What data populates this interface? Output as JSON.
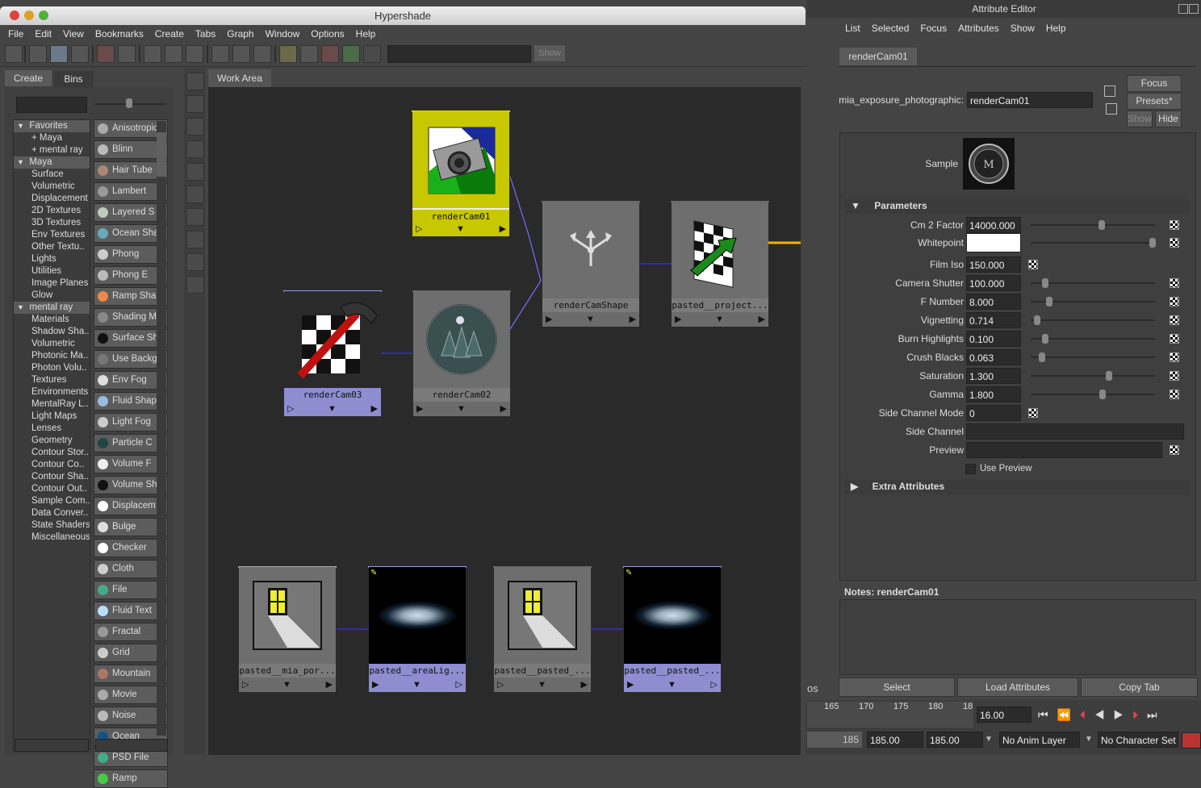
{
  "hypershade": {
    "title": "Hypershade",
    "menu": [
      "File",
      "Edit",
      "View",
      "Bookmarks",
      "Create",
      "Tabs",
      "Graph",
      "Window",
      "Options",
      "Help"
    ],
    "show_button": "Show",
    "left_tabs": [
      "Create",
      "Bins"
    ],
    "favorites": [
      {
        "label": "Favorites",
        "head": true,
        "arrow": "▼"
      },
      {
        "label": "+ Maya",
        "head": false
      },
      {
        "label": "+ mental ray",
        "head": false
      },
      {
        "label": "Maya",
        "head": true,
        "arrow": "▼"
      },
      {
        "label": "Surface"
      },
      {
        "label": "Volumetric"
      },
      {
        "label": "Displacement"
      },
      {
        "label": "2D Textures"
      },
      {
        "label": "3D Textures"
      },
      {
        "label": "Env Textures"
      },
      {
        "label": "Other Textu.."
      },
      {
        "label": "Lights"
      },
      {
        "label": "Utilities"
      },
      {
        "label": "Image Planes"
      },
      {
        "label": "Glow"
      },
      {
        "label": "mental ray",
        "head": true,
        "arrow": "▼"
      },
      {
        "label": "Materials"
      },
      {
        "label": "Shadow Sha.."
      },
      {
        "label": "Volumetric"
      },
      {
        "label": "Photonic Ma.."
      },
      {
        "label": "Photon Volu.."
      },
      {
        "label": "Textures"
      },
      {
        "label": "Environments"
      },
      {
        "label": "MentalRay L.."
      },
      {
        "label": "Light Maps"
      },
      {
        "label": "Lenses"
      },
      {
        "label": "Geometry"
      },
      {
        "label": "Contour Stor.."
      },
      {
        "label": "Contour Co.."
      },
      {
        "label": "Contour Sha.."
      },
      {
        "label": "Contour Out.."
      },
      {
        "label": "Sample Com.."
      },
      {
        "label": "Data Conver.."
      },
      {
        "label": "State Shaders"
      },
      {
        "label": "Miscellaneous"
      }
    ],
    "nodes_list": [
      {
        "label": "Anisotropic",
        "color": "#aaa"
      },
      {
        "label": "Blinn",
        "color": "#bbb"
      },
      {
        "label": "Hair Tube",
        "color": "#a87"
      },
      {
        "label": "Lambert",
        "color": "#999"
      },
      {
        "label": "Layered S",
        "color": "#bcb"
      },
      {
        "label": "Ocean Sha",
        "color": "#6ab"
      },
      {
        "label": "Phong",
        "color": "#ccc"
      },
      {
        "label": "Phong E",
        "color": "#bbb"
      },
      {
        "label": "Ramp Sha",
        "color": "#e84"
      },
      {
        "label": "Shading M",
        "color": "#888"
      },
      {
        "label": "Surface Sh",
        "color": "#111"
      },
      {
        "label": "Use Backg",
        "color": "#777"
      },
      {
        "label": "Env Fog",
        "color": "#ddd"
      },
      {
        "label": "Fluid Shap",
        "color": "#9bd"
      },
      {
        "label": "Light Fog",
        "color": "#ccc"
      },
      {
        "label": "Particle C",
        "color": "#244"
      },
      {
        "label": "Volume F",
        "color": "#eee"
      },
      {
        "label": "Volume Sh",
        "color": "#111"
      },
      {
        "label": "Displacem",
        "color": "#fff"
      },
      {
        "label": "Bulge",
        "color": "#ddd"
      },
      {
        "label": "Checker",
        "color": "#fff"
      },
      {
        "label": "Cloth",
        "color": "#ccc"
      },
      {
        "label": "File",
        "color": "#4a8"
      },
      {
        "label": "Fluid Text",
        "color": "#bdf"
      },
      {
        "label": "Fractal",
        "color": "#999"
      },
      {
        "label": "Grid",
        "color": "#ccc"
      },
      {
        "label": "Mountain",
        "color": "#a76"
      },
      {
        "label": "Movie",
        "color": "#aaa"
      },
      {
        "label": "Noise",
        "color": "#bbb"
      },
      {
        "label": "Ocean",
        "color": "#158"
      },
      {
        "label": "PSD File",
        "color": "#4a8"
      },
      {
        "label": "Ramp",
        "color": "#4c4"
      }
    ],
    "work_tab": "Work Area",
    "graph_nodes": [
      {
        "label": "renderCam01",
        "style": "selected"
      },
      {
        "label": "renderCamShape",
        "style": "normal"
      },
      {
        "label": "pasted__project...",
        "style": "normal"
      },
      {
        "label": "renderCam03",
        "style": "purple"
      },
      {
        "label": "renderCam02",
        "style": "normal"
      },
      {
        "label": "pasted__mia_por...",
        "style": "normal"
      },
      {
        "label": "pasted__areaLig...",
        "style": "purple"
      },
      {
        "label": "pasted__pasted_...",
        "style": "normal"
      },
      {
        "label": "pasted__pasted_...",
        "style": "purple"
      }
    ]
  },
  "attribute_editor": {
    "title": "Attribute Editor",
    "menu": [
      "List",
      "Selected",
      "Focus",
      "Attributes",
      "Show",
      "Help"
    ],
    "tab": "renderCam01",
    "node_type_label": "mia_exposure_photographic:",
    "node_name": "renderCam01",
    "focus_button": "Focus",
    "presets_button": "Presets*",
    "show_button": "Show",
    "hide_button": "Hide",
    "sample_label": "Sample",
    "parameters_title": "Parameters",
    "params": [
      {
        "label": "Cm 2 Factor",
        "value": "14000.000",
        "slider": 0.57
      },
      {
        "label": "Whitepoint",
        "value": "",
        "swatch": "#ffffff",
        "slider": 0.98
      },
      {
        "label": "Film Iso",
        "value": "150.000"
      },
      {
        "label": "Camera Shutter",
        "value": "100.000",
        "slider": 0.12
      },
      {
        "label": "F Number",
        "value": "8.000",
        "slider": 0.15
      },
      {
        "label": "Vignetting",
        "value": "0.714",
        "slider": 0.05
      },
      {
        "label": "Burn Highlights",
        "value": "0.100",
        "slider": 0.12
      },
      {
        "label": "Crush Blacks",
        "value": "0.063",
        "slider": 0.09
      },
      {
        "label": "Saturation",
        "value": "1.300",
        "slider": 0.63
      },
      {
        "label": "Gamma",
        "value": "1.800",
        "slider": 0.58
      },
      {
        "label": "Side Channel Mode",
        "value": "0"
      },
      {
        "label": "Side Channel",
        "value": ""
      },
      {
        "label": "Preview",
        "value": ""
      }
    ],
    "use_preview": "Use Preview",
    "extra_attributes": "Extra Attributes",
    "notes_label": "Notes:  renderCam01",
    "bottom_buttons": [
      "Select",
      "Load Attributes",
      "Copy Tab"
    ]
  },
  "timeline": {
    "ticks": [
      "165",
      "170",
      "175",
      "180",
      "18"
    ],
    "current_frame": "16.00",
    "range_start": "185",
    "range_start_field": "185.00",
    "range_end_field": "185.00",
    "anim_layer": "No Anim Layer",
    "character_set": "No Character Set",
    "partial_text": "os"
  }
}
